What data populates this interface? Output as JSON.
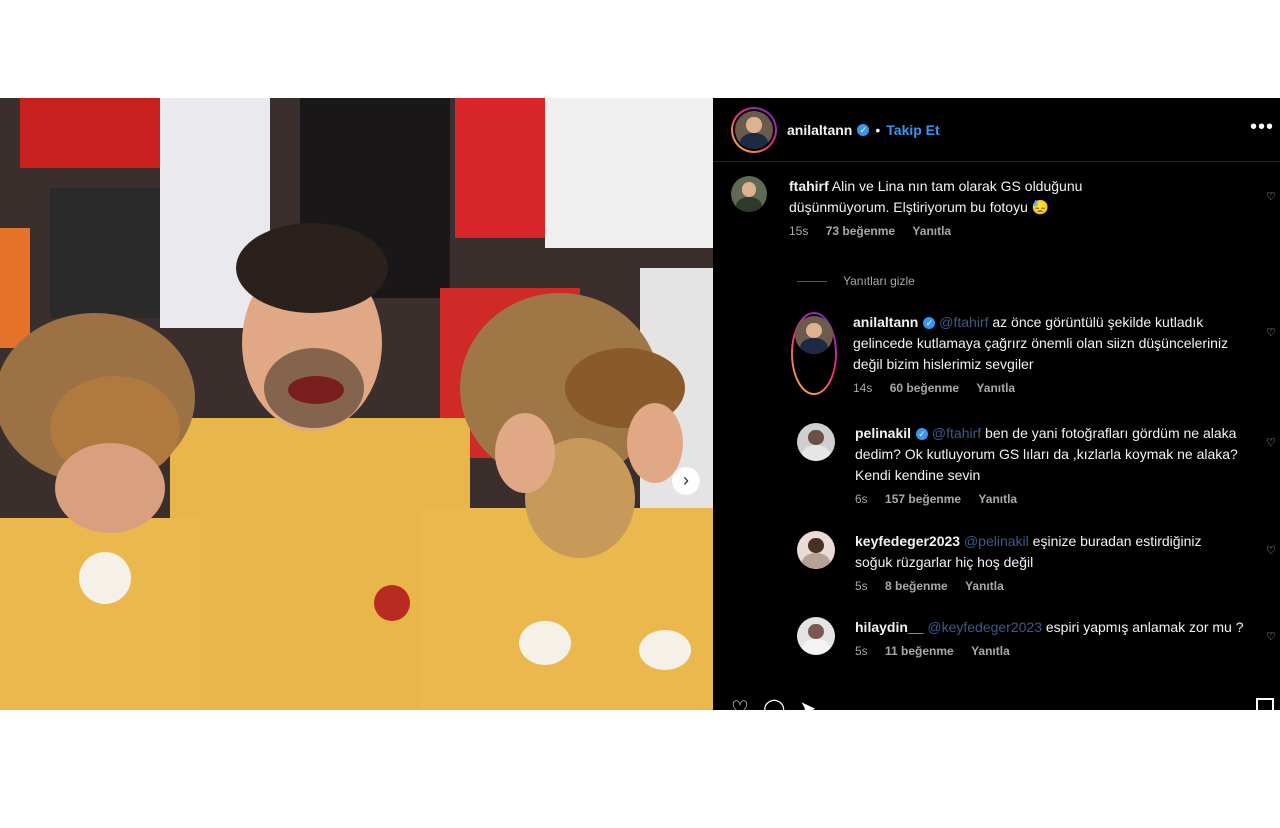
{
  "post": {
    "username": "anilaltann",
    "follow_label": "Takip Et",
    "dot": "•",
    "more": "•••"
  },
  "comments": [
    {
      "user": "ftahirf",
      "mention": "",
      "text": "Alin ve Lina nın tam olarak GS olduğunu düşünmüyorum. Elştiriyorum bu fotoyu 😓",
      "time": "15s",
      "likes": "73 beğenme",
      "reply": "Yanıtla"
    },
    {
      "user": "anilaltann",
      "mention": "@ftahirf",
      "text": " az önce görüntülü şekilde kutladık gelincede kutlamaya çağrırz önemli olan siizn düşünceleriniz değil bizim hislerimiz sevgiler",
      "time": "14s",
      "likes": "60 beğenme",
      "reply": "Yanıtla"
    },
    {
      "user": "pelinakil",
      "mention": "@ftahirf",
      "text": " ben de yani fotoğrafları gördüm ne alaka dedim? Ok kutluyorum GS lıları da ,kızlarla koymak ne alaka? Kendi kendine sevin",
      "time": "6s",
      "likes": "157 beğenme",
      "reply": "Yanıtla"
    },
    {
      "user": "keyfedeger2023",
      "mention": "@pelinakil",
      "text": " eşinize buradan estirdiğiniz soğuk rüzgarlar hiç hoş değil",
      "time": "5s",
      "likes": "8 beğenme",
      "reply": "Yanıtla"
    },
    {
      "user": "hilaydin__",
      "mention": "@keyfedeger2023",
      "text": " espiri yapmış anlamak zor mu ?",
      "time": "5s",
      "likes": "11 beğenme",
      "reply": "Yanıtla"
    }
  ],
  "hide_replies": "Yanıtları gizle",
  "icons": {
    "like": "heart-icon",
    "comment": "comment-icon",
    "share": "share-icon",
    "save": "bookmark-icon",
    "next": "chevron-right-icon"
  },
  "colors": {
    "link": "#3897f0",
    "mention": "#3b5a86",
    "jersey": "#e9b43d"
  }
}
